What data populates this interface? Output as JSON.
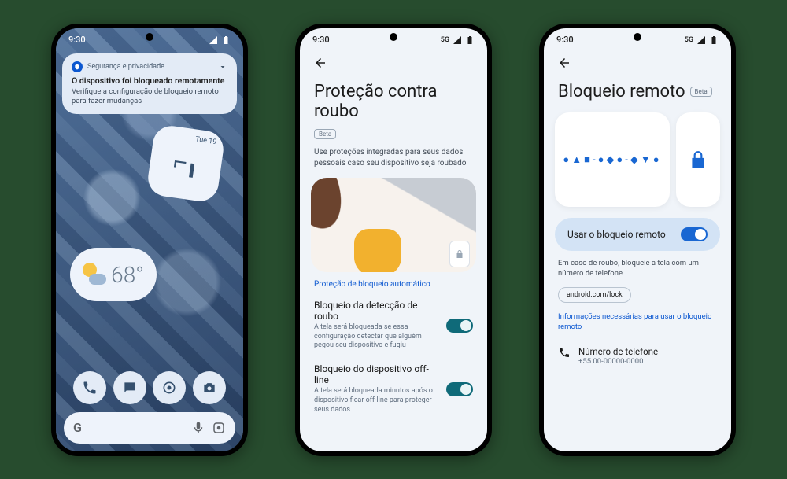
{
  "phone1": {
    "time": "9:30",
    "notification": {
      "header": "Segurança e privacidade",
      "title": "O dispositivo foi bloqueado remotamente",
      "body": "Verifique a configuração de bloqueio remoto para fazer mudanças"
    },
    "clock": {
      "date": "Tue 19"
    },
    "weather": {
      "temp": "68°"
    },
    "search": {
      "letter": "G"
    }
  },
  "phone2": {
    "time": "9:30",
    "network": "5G",
    "title": "Proteção contra roubo",
    "badge": "Beta",
    "subtitle": "Use proteções integradas para seus dados pessoais caso seu dispositivo seja roubado",
    "section": "Proteção de bloqueio automático",
    "settings": [
      {
        "title": "Bloqueio da detecção de roubo",
        "desc": "A tela será bloqueada se essa configuração detectar que alguém pegou seu dispositivo e fugiu"
      },
      {
        "title": "Bloqueio do dispositivo off-line",
        "desc": "A tela será bloqueada minutos após o dispositivo ficar off-line para proteger seus dados"
      }
    ]
  },
  "phone3": {
    "time": "9:30",
    "network": "5G",
    "title": "Bloqueio remoto",
    "badge": "Beta",
    "toggleLabel": "Usar o bloqueio remoto",
    "desc": "Em caso de roubo, bloqueie a tela com um número de telefone",
    "linkChip": "android.com/lock",
    "infoLink": "Informações necessárias para usar o bloqueio remoto",
    "phoneLabel": "Número de telefone",
    "phoneNumber": "+55 00-00000-0000"
  }
}
